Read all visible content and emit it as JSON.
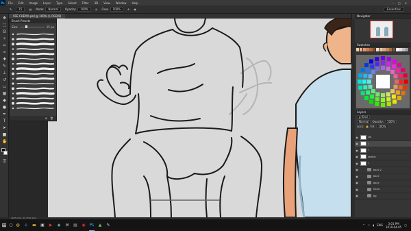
{
  "app": {
    "logo": "Ps",
    "menu": [
      "File",
      "Edit",
      "Image",
      "Layer",
      "Type",
      "Select",
      "Filter",
      "3D",
      "View",
      "Window",
      "Help"
    ],
    "window_controls": [
      "–",
      "□",
      "✕"
    ]
  },
  "options": {
    "brush_size": "15",
    "mode_label": "Mode:",
    "mode_value": "Normal",
    "opacity_label": "Opacity:",
    "opacity_value": "100%",
    "flow_label": "Flow:",
    "flow_value": "100%",
    "workspace": "Essentials"
  },
  "document": {
    "tab_title": "SSE CHEMA.psd @ 100% (l, RGB/8)",
    "status": "100%     Doc: 29.7M/1.13G"
  },
  "brush_panel": {
    "title": "Brush Presets",
    "size_label": "Size:",
    "size_value": "15 px",
    "brush_count": 16
  },
  "navigator": {
    "title": "Navigator"
  },
  "swatches": {
    "title": "Swatches",
    "colors": [
      "#f2c9a8",
      "#e8b48e",
      "#d99a70",
      "#c97f55",
      "#b06640",
      "#8a4a2c",
      "#f5e0c8",
      "#e6c6a0",
      "#d5a77c",
      "#c28a5e",
      "#a56c45",
      "#7d4e30",
      "#ffffff",
      "#e0e0e0",
      "#bdbdbd",
      "#9a9a9a"
    ]
  },
  "layers": {
    "title": "Layers",
    "kind_label": "ρ Kind",
    "blend": "Normal",
    "opacity_label": "Opacity:",
    "opacity_value": "100%",
    "lock_label": "Lock:",
    "fill_label": "Fill:",
    "fill_value": "100%",
    "items": [
      {
        "name": "col",
        "type": "layer",
        "selected": false
      },
      {
        "name": "l",
        "type": "layer",
        "selected": true
      },
      {
        "name": "l",
        "type": "layer",
        "selected": false
      },
      {
        "name": "sketch",
        "type": "layer",
        "selected": false
      },
      {
        "name": "l",
        "type": "layer",
        "selected": false
      },
      {
        "name": "back 2",
        "type": "group",
        "selected": false
      },
      {
        "name": "back",
        "type": "group",
        "selected": false
      },
      {
        "name": "back",
        "type": "group",
        "selected": false
      },
      {
        "name": "head",
        "type": "group",
        "selected": false
      },
      {
        "name": "bg",
        "type": "group",
        "selected": false
      }
    ]
  },
  "taskbar": {
    "time": "3:01 PM",
    "date": "2019-04-05",
    "lang": "ENG"
  }
}
